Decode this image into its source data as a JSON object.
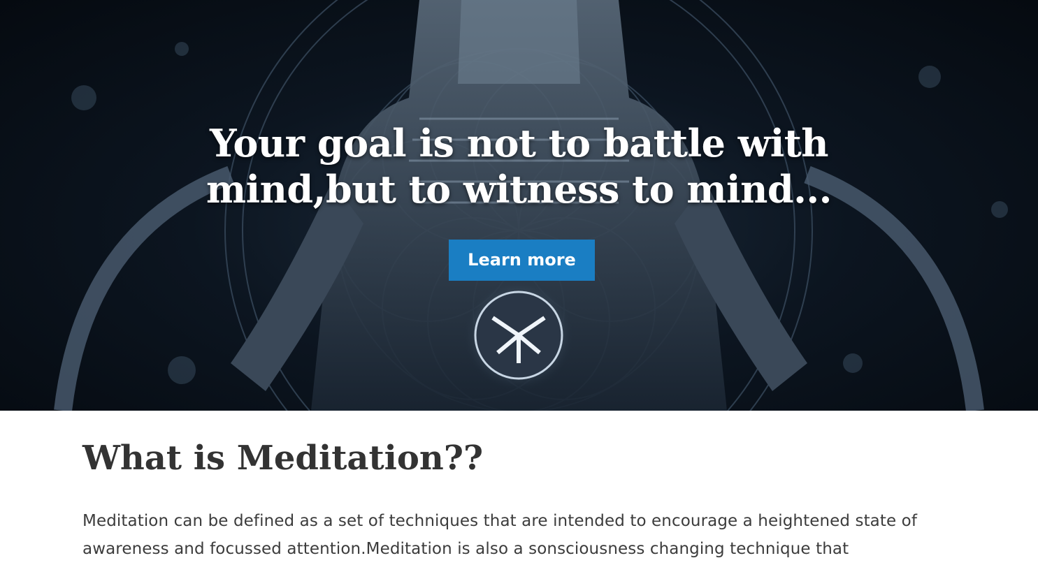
{
  "hero": {
    "headline_line1": "Your goal is not to battle with",
    "headline_line2": "mind,but to witness to mind...",
    "button_label": "Learn more",
    "button_color": "#1a7ec3",
    "image_subject": "meditating-cyborg-figure"
  },
  "section": {
    "title": "What is Meditation??",
    "body": "Meditation can be defined as a set of techniques that are intended to encourage a heightened state of awareness and focussed attention.Meditation is also a sonsciousness changing technique that"
  }
}
